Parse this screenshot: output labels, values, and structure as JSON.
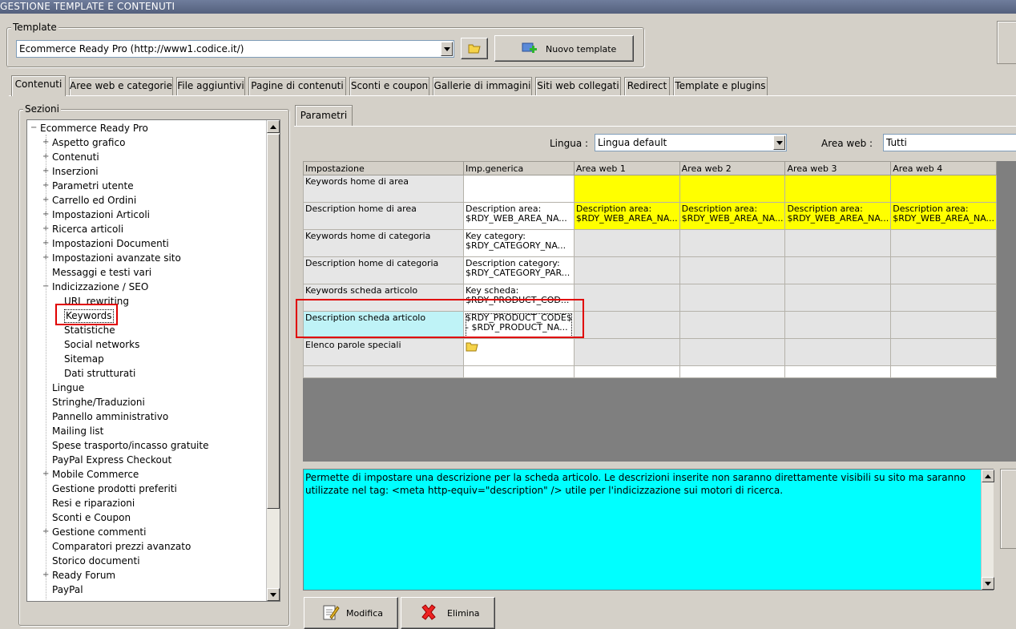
{
  "window": {
    "title": "GESTIONE TEMPLATE E CONTENUTI"
  },
  "template": {
    "group_label": "Template",
    "selected": "Ecommerce Ready Pro (http://www1.codice.it/)",
    "new_button": "Nuovo template"
  },
  "tabs": [
    {
      "label": "Contenuti",
      "active": true
    },
    {
      "label": "Aree web e categorie"
    },
    {
      "label": "File aggiuntivi"
    },
    {
      "label": "Pagine di contenuti"
    },
    {
      "label": "Sconti e coupon"
    },
    {
      "label": "Gallerie di immagini"
    },
    {
      "label": "Siti web collegati"
    },
    {
      "label": "Redirect"
    },
    {
      "label": "Template e plugins"
    }
  ],
  "sections": {
    "group_label": "Sezioni",
    "items": [
      {
        "label": "Ecommerce Ready Pro",
        "toggle": "−",
        "level": 0
      },
      {
        "label": "Aspetto grafico",
        "toggle": "+",
        "level": 1
      },
      {
        "label": "Contenuti",
        "toggle": "+",
        "level": 1
      },
      {
        "label": "Inserzioni",
        "toggle": "+",
        "level": 1
      },
      {
        "label": "Parametri utente",
        "toggle": "+",
        "level": 1
      },
      {
        "label": "Carrello ed Ordini",
        "toggle": "+",
        "level": 1
      },
      {
        "label": "Impostazioni Articoli",
        "toggle": "+",
        "level": 1
      },
      {
        "label": "Ricerca articoli",
        "toggle": "+",
        "level": 1
      },
      {
        "label": "Impostazioni Documenti",
        "toggle": "+",
        "level": 1
      },
      {
        "label": "Impostazioni avanzate sito",
        "toggle": "+",
        "level": 1
      },
      {
        "label": "Messaggi e testi vari",
        "toggle": "",
        "level": 1
      },
      {
        "label": "Indicizzazione / SEO",
        "toggle": "−",
        "level": 1
      },
      {
        "label": "URL rewriting",
        "toggle": "",
        "level": 2
      },
      {
        "label": "Keywords",
        "toggle": "",
        "level": 2,
        "selected": true
      },
      {
        "label": "Statistiche",
        "toggle": "",
        "level": 2
      },
      {
        "label": "Social networks",
        "toggle": "",
        "level": 2
      },
      {
        "label": "Sitemap",
        "toggle": "",
        "level": 2
      },
      {
        "label": "Dati strutturati",
        "toggle": "",
        "level": 2
      },
      {
        "label": "Lingue",
        "toggle": "",
        "level": 1
      },
      {
        "label": "Stringhe/Traduzioni",
        "toggle": "",
        "level": 1
      },
      {
        "label": "Pannello amministrativo",
        "toggle": "",
        "level": 1
      },
      {
        "label": "Mailing list",
        "toggle": "",
        "level": 1
      },
      {
        "label": "Spese trasporto/incasso gratuite",
        "toggle": "",
        "level": 1
      },
      {
        "label": "PayPal Express Checkout",
        "toggle": "",
        "level": 1
      },
      {
        "label": "Mobile Commerce",
        "toggle": "+",
        "level": 1
      },
      {
        "label": "Gestione prodotti preferiti",
        "toggle": "",
        "level": 1
      },
      {
        "label": "Resi e riparazioni",
        "toggle": "",
        "level": 1
      },
      {
        "label": "Sconti e Coupon",
        "toggle": "",
        "level": 1
      },
      {
        "label": "Gestione commenti",
        "toggle": "+",
        "level": 1
      },
      {
        "label": "Comparatori prezzi avanzato",
        "toggle": "",
        "level": 1
      },
      {
        "label": "Storico documenti",
        "toggle": "",
        "level": 1
      },
      {
        "label": "Ready Forum",
        "toggle": "+",
        "level": 1
      },
      {
        "label": "PayPal",
        "toggle": "",
        "level": 1
      }
    ]
  },
  "params": {
    "tab_label": "Parametri",
    "lingua_label": "Lingua :",
    "lingua_value": "Lingua default",
    "area_label": "Area web :",
    "area_value": "Tutti"
  },
  "grid": {
    "headers": [
      "Impostazione",
      "Imp.generica",
      "Area web 1",
      "Area web 2",
      "Area web 3",
      "Area web 4"
    ],
    "rows": [
      {
        "name": "Keywords home di area",
        "generic": [
          "",
          ""
        ],
        "areas": [
          [
            "",
            ""
          ],
          [
            "",
            ""
          ],
          [
            "",
            ""
          ],
          [
            "",
            ""
          ]
        ],
        "area_style": "yellow",
        "generic_style": "white"
      },
      {
        "name": "Description home di area",
        "generic": [
          "Description area:",
          "$RDY_WEB_AREA_NA..."
        ],
        "areas": [
          [
            "Description area:",
            "$RDY_WEB_AREA_NA..."
          ],
          [
            "Description area:",
            "$RDY_WEB_AREA_NA..."
          ],
          [
            "Description area:",
            "$RDY_WEB_AREA_NA..."
          ],
          [
            "Description area:",
            "$RDY_WEB_AREA_NA..."
          ]
        ],
        "area_style": "yellow",
        "generic_style": "white"
      },
      {
        "name": "Keywords home di categoria",
        "generic": [
          "Key category:",
          "$RDY_CATEGORY_NA..."
        ],
        "areas": [
          [
            "",
            ""
          ],
          [
            "",
            ""
          ],
          [
            "",
            ""
          ],
          [
            "",
            ""
          ]
        ],
        "area_style": "gray",
        "generic_style": "white"
      },
      {
        "name": "Description home di categoria",
        "generic": [
          "Description category:",
          "$RDY_CATEGORY_PAR..."
        ],
        "areas": [
          [
            "",
            ""
          ],
          [
            "",
            ""
          ],
          [
            "",
            ""
          ],
          [
            "",
            ""
          ]
        ],
        "area_style": "gray",
        "generic_style": "white"
      },
      {
        "name": "Keywords scheda articolo",
        "generic": [
          "Key scheda:",
          "$RDY_PRODUCT_COD..."
        ],
        "areas": [
          [
            "",
            ""
          ],
          [
            "",
            ""
          ],
          [
            "",
            ""
          ],
          [
            "",
            ""
          ]
        ],
        "area_style": "gray",
        "generic_style": "white"
      },
      {
        "name": "Description scheda articolo",
        "generic": [
          "$RDY_PRODUCT_CODE$",
          "- $RDY_PRODUCT_NA..."
        ],
        "areas": [
          [
            "",
            ""
          ],
          [
            "",
            ""
          ],
          [
            "",
            ""
          ],
          [
            "",
            ""
          ]
        ],
        "area_style": "gray",
        "generic_style": "white",
        "selected": true
      },
      {
        "name": "Elenco parole speciali",
        "generic": [
          "",
          ""
        ],
        "areas": [
          [
            "",
            ""
          ],
          [
            "",
            ""
          ],
          [
            "",
            ""
          ],
          [
            "",
            ""
          ]
        ],
        "area_style": "gray",
        "generic_style": "white",
        "folder_icon": true
      }
    ]
  },
  "description": "Permette di impostare una descrizione per la scheda articolo. Le descrizioni inserite non saranno direttamente visibili su sito ma saranno utilizzate nel tag: <meta http-equiv=\"description\" /> utile per l'indicizzazione sui motori di ricerca.",
  "buttons": {
    "modifica": "Modifica",
    "elimina": "Elimina"
  },
  "colors": {
    "area_highlight": "#ffff00",
    "description_bg": "#00ffff",
    "selected_row": "#bff3f7",
    "annotation_red": "#e00000"
  }
}
